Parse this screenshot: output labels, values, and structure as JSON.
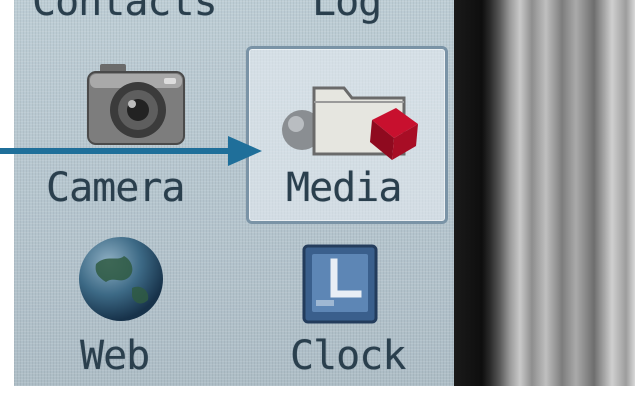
{
  "menu": {
    "items": [
      {
        "label": "Contacts",
        "icon": "contacts-icon"
      },
      {
        "label": "Log",
        "icon": "log-icon"
      },
      {
        "label": "Camera",
        "icon": "camera-icon"
      },
      {
        "label": "Media",
        "icon": "media-folder-icon",
        "selected": true
      },
      {
        "label": "Web",
        "icon": "globe-icon"
      },
      {
        "label": "Clock",
        "icon": "clock-icon"
      }
    ]
  },
  "annotation": {
    "icon": "pointer-arrow",
    "color": "#1f6f9a"
  },
  "colors": {
    "screen_bg": "#b5c6cf",
    "text": "#2a3f4d",
    "selection_border": "#7a93a6"
  }
}
